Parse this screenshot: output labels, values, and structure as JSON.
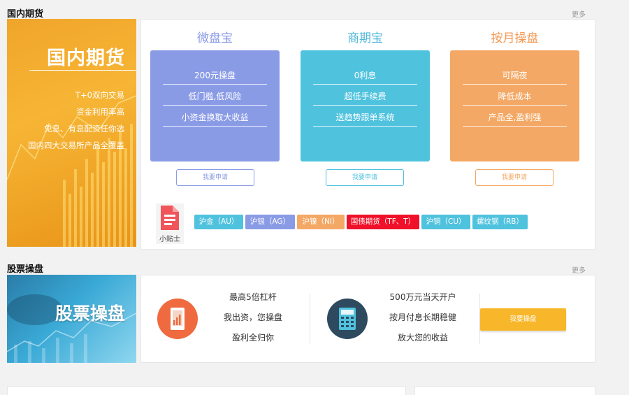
{
  "futures": {
    "section_title": "国内期货",
    "more": "更多",
    "banner": {
      "title": "国内期货",
      "lines": [
        "T+0双向交易",
        "资金利用率高",
        "免息、有息配资任你选",
        "国内四大交易所产品全覆盖"
      ]
    },
    "products": [
      {
        "name": "微盘宝",
        "color": "#8a9be6",
        "title_color": "#8a9be6",
        "rows": [
          "200元操盘",
          "低门槛,低风险",
          "小资金换取大收益"
        ],
        "apply": "我要申请"
      },
      {
        "name": "商期宝",
        "color": "#4fc2de",
        "title_color": "#4fb8dc",
        "rows": [
          "0利息",
          "超低手续费",
          "送趋势跟单系统"
        ],
        "apply": "我要申请"
      },
      {
        "name": "按月操盘",
        "color": "#f4a865",
        "title_color": "#f29a56",
        "rows": [
          "可隔夜",
          "降低成本",
          "产品全,盈利强"
        ],
        "apply": "我要申请"
      }
    ],
    "tips_label": "小贴士",
    "tags": [
      {
        "label": "沪金（AU）",
        "color": "#4fc2de"
      },
      {
        "label": "沪银（AG）",
        "color": "#8a9be6"
      },
      {
        "label": "沪镍（NI）",
        "color": "#f4a865"
      },
      {
        "label": "国债期货（TF、T）",
        "color": "#f0102a"
      },
      {
        "label": "沪铜（CU）",
        "color": "#4fc2de"
      },
      {
        "label": "螺纹钢（RB）",
        "color": "#4fc2de"
      }
    ]
  },
  "stocks": {
    "section_title": "股票操盘",
    "more": "更多",
    "banner": {
      "title": "股票操盘"
    },
    "feature1": [
      "最高5倍杠杆",
      "我出资，您操盘",
      "盈利全归你"
    ],
    "feature2": [
      "500万元当天开户",
      "按月付息长期稳健",
      "放大您的收益"
    ],
    "apply": "我要操盘"
  }
}
